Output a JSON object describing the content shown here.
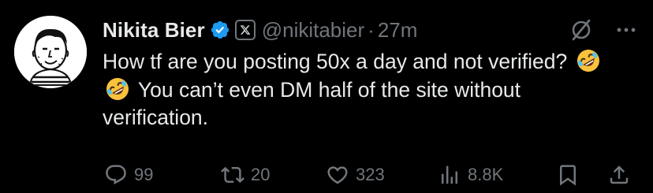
{
  "author": {
    "name": "Nikita Bier",
    "handle": "@nikitabier",
    "time": "27m",
    "separator": "·"
  },
  "tweet": {
    "text_1": "How tf are you posting 50x a day and not verified?",
    "text_2": "You can’t even DM half of the site without verification.",
    "emojis": [
      "rolling-on-floor-laughing",
      "rolling-on-floor-laughing"
    ]
  },
  "actions": {
    "replies": "99",
    "reposts": "20",
    "likes": "323",
    "views": "8.8K"
  },
  "colors": {
    "background": "#000000",
    "text": "#e7e9ea",
    "muted": "#71767b",
    "verified": "#1d9bf0"
  },
  "icons": [
    "verified-badge-icon",
    "x-affiliation-icon",
    "grok-icon",
    "more-icon",
    "reply-icon",
    "repost-icon",
    "like-icon",
    "views-icon",
    "bookmark-icon",
    "share-icon"
  ]
}
